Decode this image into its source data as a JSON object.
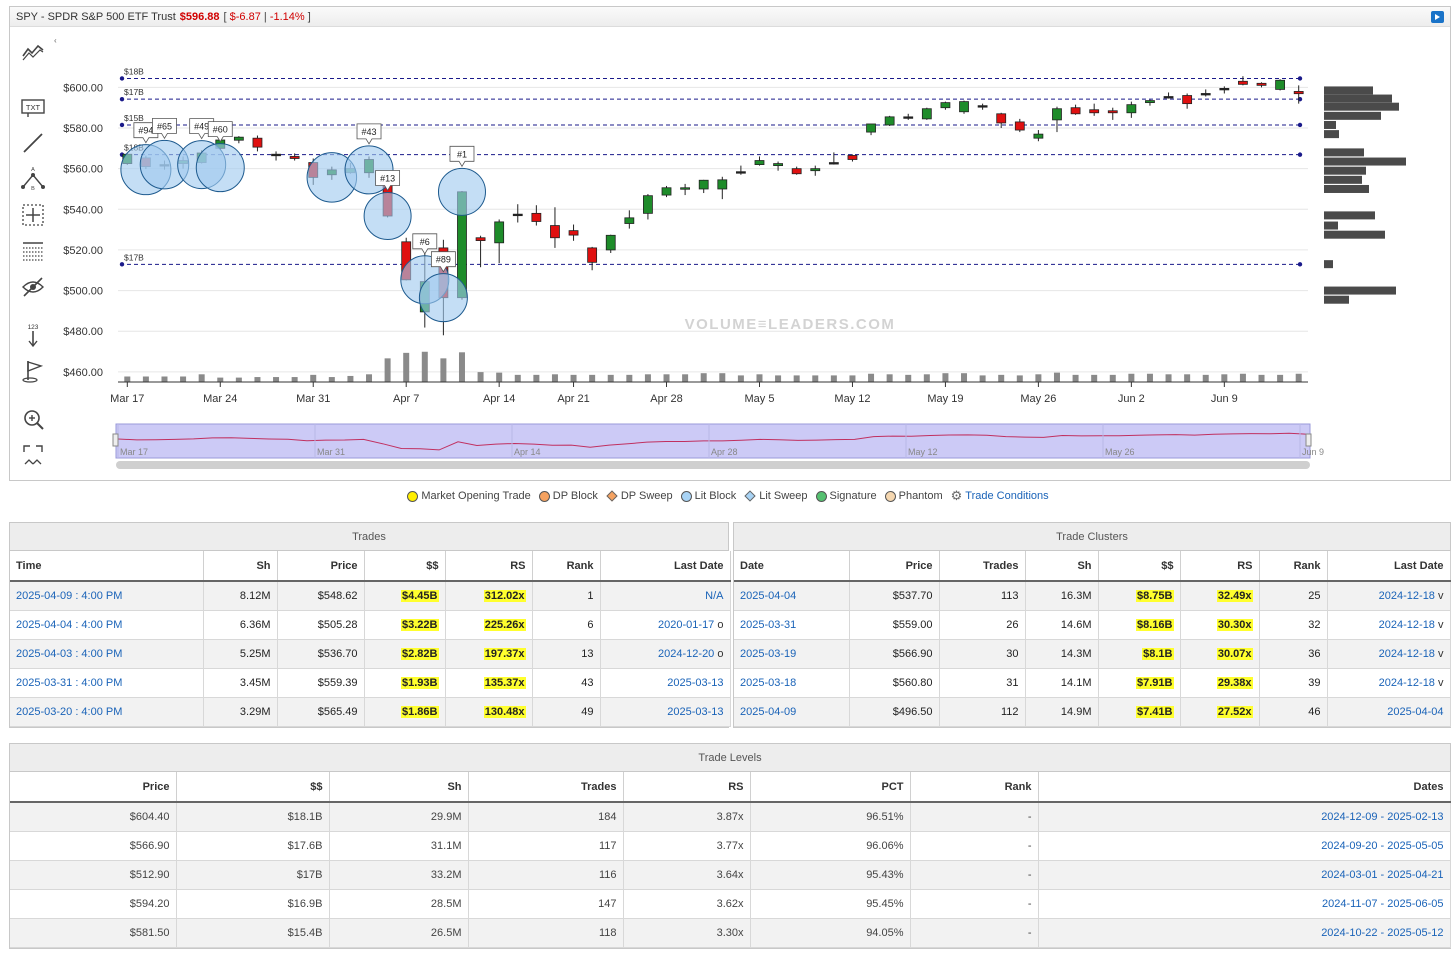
{
  "header": {
    "title": "SPY - SPDR S&P 500 ETF Trust",
    "price": "$596.88",
    "change_open": "[",
    "change_value": "$-6.87",
    "change_sep": "|",
    "change_pct": "-1.14%",
    "change_close": "]"
  },
  "toolbar": {
    "tools": [
      {
        "icon": "trend-tools-icon"
      },
      {
        "icon": "text-annotation-icon",
        "label": "TXT"
      },
      {
        "icon": "line-tool-icon"
      },
      {
        "icon": "fibonacci-tool-icon"
      },
      {
        "icon": "crosshair-measure-icon"
      },
      {
        "icon": "grid-lines-icon"
      },
      {
        "icon": "hide-annotations-icon"
      },
      {
        "icon": "number-sort-icon",
        "label": "123"
      },
      {
        "icon": "flag-marker-icon"
      },
      {
        "icon": "zoom-icon"
      },
      {
        "icon": "fullscreen-toggle-icon"
      }
    ]
  },
  "colors": {
    "up": "#1e8c2a",
    "down": "#e01010",
    "bubble": "#9fcaef",
    "level_line": "#1a1a8a",
    "volume": "#8a8a8a",
    "bar_profile": "#4a4a4a",
    "navigator_fill": "#cccaf6",
    "navigator_line": "#c03060",
    "highlight": "#ffff2e",
    "link": "#1a63b8"
  },
  "chart_data": {
    "type": "candlestick",
    "ylim": [
      455,
      612
    ],
    "y_ticks": [
      "$460.00",
      "$480.00",
      "$500.00",
      "$520.00",
      "$540.00",
      "$560.00",
      "$580.00",
      "$600.00"
    ],
    "y_tick_values": [
      460,
      480,
      500,
      520,
      540,
      560,
      580,
      600
    ],
    "x_labels": [
      "Mar 17",
      "Mar 24",
      "Mar 31",
      "Apr 7",
      "Apr 14",
      "Apr 21",
      "Apr 28",
      "May 5",
      "May 12",
      "May 19",
      "May 26",
      "Jun 2",
      "Jun 9"
    ],
    "x_label_index": [
      0,
      5,
      10,
      15,
      20,
      24,
      29,
      34,
      39,
      44,
      49,
      54,
      59
    ],
    "candles": [
      [
        562.5,
        567.8,
        561.9,
        567.1
      ],
      [
        565.3,
        566.4,
        559.8,
        561.0
      ],
      [
        562.0,
        564.0,
        559.5,
        561.5
      ],
      [
        562.5,
        566.0,
        560.0,
        564.0
      ],
      [
        563.0,
        569.0,
        562.5,
        567.7
      ],
      [
        570.0,
        575.2,
        569.5,
        574.1
      ],
      [
        574.0,
        576.0,
        572.5,
        575.5
      ],
      [
        575.0,
        576.3,
        568.5,
        570.6
      ],
      [
        567.0,
        568.5,
        564.0,
        567.1
      ],
      [
        566.0,
        567.5,
        564.0,
        565.0
      ],
      [
        563.0,
        565.0,
        552.0,
        555.7
      ],
      [
        557.0,
        561.0,
        554.5,
        559.4
      ],
      [
        558.0,
        562.8,
        557.5,
        560.1
      ],
      [
        558.0,
        566.0,
        555.5,
        564.5
      ],
      [
        554.0,
        555.5,
        536.0,
        536.7
      ],
      [
        524.0,
        526.0,
        505.0,
        505.3
      ],
      [
        489.5,
        523.2,
        481.8,
        504.4
      ],
      [
        521.0,
        525.0,
        478.0,
        496.5
      ],
      [
        496.5,
        549.0,
        495.5,
        548.6
      ],
      [
        526.0,
        527.0,
        511.5,
        524.6
      ],
      [
        523.5,
        535.0,
        513.5,
        533.8
      ],
      [
        537.5,
        542.5,
        533.5,
        537.6
      ],
      [
        538.0,
        542.0,
        532.0,
        534.0
      ],
      [
        532.0,
        541.0,
        521.0,
        526.0
      ],
      [
        529.5,
        532.5,
        524.5,
        527.3
      ],
      [
        521.0,
        521.5,
        510.0,
        513.9
      ],
      [
        520.0,
        527.5,
        518.5,
        527.2
      ],
      [
        533.0,
        539.5,
        530.5,
        535.8
      ],
      [
        538.0,
        547.5,
        535.0,
        546.7
      ],
      [
        547.0,
        551.5,
        546.0,
        550.6
      ],
      [
        550.0,
        552.5,
        547.0,
        550.6
      ],
      [
        550.0,
        554.5,
        548.0,
        554.3
      ],
      [
        550.0,
        556.0,
        545.0,
        554.5
      ],
      [
        558.0,
        561.5,
        557.0,
        558.5
      ],
      [
        562.0,
        566.0,
        561.5,
        564.0
      ],
      [
        561.5,
        563.5,
        559.0,
        562.5
      ],
      [
        560.0,
        561.0,
        557.0,
        557.5
      ],
      [
        559.0,
        561.5,
        556.5,
        560.0
      ],
      [
        563.0,
        568.0,
        562.0,
        563.0
      ],
      [
        566.5,
        567.0,
        563.5,
        564.5
      ],
      [
        578.0,
        582.0,
        576.5,
        582.0
      ],
      [
        581.5,
        586.0,
        581.0,
        585.5
      ],
      [
        585.5,
        587.0,
        584.0,
        585.0
      ],
      [
        584.5,
        590.0,
        584.0,
        589.5
      ],
      [
        590.0,
        593.0,
        589.0,
        592.5
      ],
      [
        588.0,
        593.5,
        587.0,
        593.0
      ],
      [
        591.0,
        592.0,
        589.0,
        590.5
      ],
      [
        587.0,
        587.5,
        580.0,
        582.5
      ],
      [
        583.0,
        584.5,
        578.0,
        579.0
      ],
      [
        575.0,
        579.0,
        573.5,
        577.0
      ],
      [
        584.0,
        590.5,
        578.0,
        589.5
      ],
      [
        590.0,
        591.5,
        586.5,
        587.0
      ],
      [
        589.0,
        592.0,
        586.0,
        587.5
      ],
      [
        588.5,
        590.0,
        584.0,
        587.5
      ],
      [
        587.5,
        593.0,
        585.0,
        591.5
      ],
      [
        592.5,
        594.0,
        591.0,
        593.5
      ],
      [
        595.5,
        597.5,
        594.5,
        595.0
      ],
      [
        596.0,
        597.0,
        589.5,
        592.0
      ],
      [
        597.0,
        599.0,
        595.5,
        597.0
      ],
      [
        599.0,
        600.5,
        597.0,
        599.5
      ],
      [
        603.0,
        605.5,
        601.0,
        601.5
      ],
      [
        602.0,
        602.5,
        600.0,
        601.0
      ],
      [
        599.0,
        604.0,
        598.5,
        603.5
      ],
      [
        598.0,
        601.0,
        592.0,
        596.9
      ]
    ],
    "volume_rel": [
      0.1,
      0.1,
      0.1,
      0.1,
      0.14,
      0.08,
      0.08,
      0.09,
      0.09,
      0.09,
      0.13,
      0.09,
      0.11,
      0.14,
      0.43,
      0.53,
      0.55,
      0.43,
      0.54,
      0.18,
      0.17,
      0.13,
      0.13,
      0.14,
      0.13,
      0.13,
      0.13,
      0.13,
      0.14,
      0.14,
      0.14,
      0.16,
      0.16,
      0.12,
      0.14,
      0.12,
      0.12,
      0.12,
      0.12,
      0.12,
      0.15,
      0.14,
      0.13,
      0.14,
      0.16,
      0.16,
      0.12,
      0.13,
      0.12,
      0.14,
      0.17,
      0.13,
      0.13,
      0.13,
      0.15,
      0.15,
      0.14,
      0.14,
      0.13,
      0.14,
      0.15,
      0.13,
      0.13,
      0.15
    ],
    "levels": [
      {
        "price": 604.4,
        "label": "$18B"
      },
      {
        "price": 594.2,
        "label": "$17B"
      },
      {
        "price": 581.5,
        "label": "$15B"
      },
      {
        "price": 566.9,
        "label": "$18B"
      },
      {
        "price": 512.9,
        "label": "$17B"
      }
    ],
    "bubbles": [
      {
        "index": 1,
        "price": 559.5,
        "size": 1.0,
        "label": "#94"
      },
      {
        "index": 2,
        "price": 562.0,
        "size": 0.97,
        "label": "#65"
      },
      {
        "index": 4,
        "price": 562.0,
        "size": 0.96,
        "label": "#49"
      },
      {
        "index": 5,
        "price": 560.5,
        "size": 0.96,
        "label": "#60"
      },
      {
        "index": 11,
        "price": 555.7,
        "size": 0.99,
        "label": ""
      },
      {
        "index": 13,
        "price": 559.4,
        "size": 0.96,
        "label": "#43"
      },
      {
        "index": 14,
        "price": 536.7,
        "size": 0.94,
        "label": "#13"
      },
      {
        "index": 16,
        "price": 505.3,
        "size": 0.96,
        "label": "#6"
      },
      {
        "index": 17,
        "price": 496.5,
        "size": 0.96,
        "label": "#89"
      },
      {
        "index": 18,
        "price": 548.6,
        "size": 0.94,
        "label": "#1"
      }
    ],
    "price_profile": [
      {
        "price": 598.5,
        "w": 49
      },
      {
        "price": 594.5,
        "w": 68
      },
      {
        "price": 590.5,
        "w": 75
      },
      {
        "price": 586.0,
        "w": 57
      },
      {
        "price": 581.5,
        "w": 12
      },
      {
        "price": 577.0,
        "w": 15
      },
      {
        "price": 568.0,
        "w": 40
      },
      {
        "price": 563.5,
        "w": 82
      },
      {
        "price": 559.0,
        "w": 42
      },
      {
        "price": 554.5,
        "w": 38
      },
      {
        "price": 550.0,
        "w": 45
      },
      {
        "price": 537.0,
        "w": 51
      },
      {
        "price": 532.0,
        "w": 14
      },
      {
        "price": 527.5,
        "w": 61
      },
      {
        "price": 513.0,
        "w": 9
      },
      {
        "price": 500.0,
        "w": 72
      },
      {
        "price": 495.5,
        "w": 25
      }
    ],
    "navigator_labels": [
      "Mar 17",
      "Mar 31",
      "Apr 14",
      "Apr 28",
      "May 12",
      "May 26",
      "Jun 9"
    ],
    "watermark": "VOLUME≡LEADERS.COM"
  },
  "legend": [
    {
      "label": "Market Opening Trade",
      "color": "#ffee00",
      "shape": "dot"
    },
    {
      "label": "DP Block",
      "color": "#f5a260",
      "shape": "dot"
    },
    {
      "label": "DP Sweep",
      "color": "#f5a260",
      "shape": "diamond"
    },
    {
      "label": "Lit Block",
      "color": "#a8d3f5",
      "shape": "dot"
    },
    {
      "label": "Lit Sweep",
      "color": "#a8d3f5",
      "shape": "diamond"
    },
    {
      "label": "Signature",
      "color": "#55c070",
      "shape": "dot"
    },
    {
      "label": "Phantom",
      "color": "#f5d7b0",
      "shape": "dot"
    },
    {
      "label": "Trade Conditions",
      "color": "",
      "shape": "gear"
    }
  ],
  "trades": {
    "caption": "Trades",
    "columns": [
      "Time",
      "Sh",
      "Price",
      "$$",
      "RS",
      "Rank",
      "Last Date"
    ],
    "rows": [
      {
        "time": "2025-04-09 : 4:00 PM",
        "sh": "8.12M",
        "price": "$548.62",
        "dollars": "$4.45B",
        "rs": "312.02x",
        "rank": "1",
        "last_date": "N/A",
        "flag": ""
      },
      {
        "time": "2025-04-04 : 4:00 PM",
        "sh": "6.36M",
        "price": "$505.28",
        "dollars": "$3.22B",
        "rs": "225.26x",
        "rank": "6",
        "last_date": "2020-01-17",
        "flag": "o"
      },
      {
        "time": "2025-04-03 : 4:00 PM",
        "sh": "5.25M",
        "price": "$536.70",
        "dollars": "$2.82B",
        "rs": "197.37x",
        "rank": "13",
        "last_date": "2024-12-20",
        "flag": "o"
      },
      {
        "time": "2025-03-31 : 4:00 PM",
        "sh": "3.45M",
        "price": "$559.39",
        "dollars": "$1.93B",
        "rs": "135.37x",
        "rank": "43",
        "last_date": "2025-03-13",
        "flag": ""
      },
      {
        "time": "2025-03-20 : 4:00 PM",
        "sh": "3.29M",
        "price": "$565.49",
        "dollars": "$1.86B",
        "rs": "130.48x",
        "rank": "49",
        "last_date": "2025-03-13",
        "flag": ""
      }
    ]
  },
  "clusters": {
    "caption": "Trade Clusters",
    "columns": [
      "Date",
      "Price",
      "Trades",
      "Sh",
      "$$",
      "RS",
      "Rank",
      "Last Date"
    ],
    "rows": [
      {
        "date": "2025-04-04",
        "price": "$537.70",
        "trades": "113",
        "sh": "16.3M",
        "dollars": "$8.75B",
        "rs": "32.49x",
        "rank": "25",
        "last_date": "2024-12-18",
        "flag": "v"
      },
      {
        "date": "2025-03-31",
        "price": "$559.00",
        "trades": "26",
        "sh": "14.6M",
        "dollars": "$8.16B",
        "rs": "30.30x",
        "rank": "32",
        "last_date": "2024-12-18",
        "flag": "v"
      },
      {
        "date": "2025-03-19",
        "price": "$566.90",
        "trades": "30",
        "sh": "14.3M",
        "dollars": "$8.1B",
        "rs": "30.07x",
        "rank": "36",
        "last_date": "2024-12-18",
        "flag": "v"
      },
      {
        "date": "2025-03-18",
        "price": "$560.80",
        "trades": "31",
        "sh": "14.1M",
        "dollars": "$7.91B",
        "rs": "29.38x",
        "rank": "39",
        "last_date": "2024-12-18",
        "flag": "v"
      },
      {
        "date": "2025-04-09",
        "price": "$496.50",
        "trades": "112",
        "sh": "14.9M",
        "dollars": "$7.41B",
        "rs": "27.52x",
        "rank": "46",
        "last_date": "2025-04-04",
        "flag": ""
      }
    ]
  },
  "levels": {
    "caption": "Trade Levels",
    "columns": [
      "Price",
      "$$",
      "Sh",
      "Trades",
      "RS",
      "PCT",
      "Rank",
      "Dates"
    ],
    "rows": [
      {
        "price": "$604.40",
        "dollars": "$18.1B",
        "sh": "29.9M",
        "trades": "184",
        "rs": "3.87x",
        "pct": "96.51%",
        "rank": "-",
        "dates": "2024-12-09 - 2025-02-13"
      },
      {
        "price": "$566.90",
        "dollars": "$17.6B",
        "sh": "31.1M",
        "trades": "117",
        "rs": "3.77x",
        "pct": "96.06%",
        "rank": "-",
        "dates": "2024-09-20 - 2025-05-05"
      },
      {
        "price": "$512.90",
        "dollars": "$17B",
        "sh": "33.2M",
        "trades": "116",
        "rs": "3.64x",
        "pct": "95.43%",
        "rank": "-",
        "dates": "2024-03-01 - 2025-04-21"
      },
      {
        "price": "$594.20",
        "dollars": "$16.9B",
        "sh": "28.5M",
        "trades": "147",
        "rs": "3.62x",
        "pct": "95.45%",
        "rank": "-",
        "dates": "2024-11-07 - 2025-06-05"
      },
      {
        "price": "$581.50",
        "dollars": "$15.4B",
        "sh": "26.5M",
        "trades": "118",
        "rs": "3.30x",
        "pct": "94.05%",
        "rank": "-",
        "dates": "2024-10-22 - 2025-05-12"
      }
    ]
  }
}
